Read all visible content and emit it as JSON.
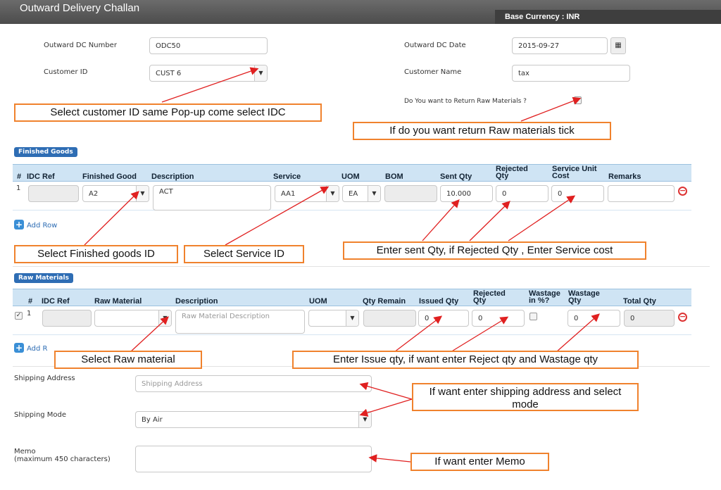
{
  "header": {
    "title": "Outward Delivery Challan",
    "currency": "Base Currency : INR"
  },
  "form": {
    "dc_number_label": "Outward DC Number",
    "dc_number_value": "ODC50",
    "dc_date_label": "Outward DC Date",
    "dc_date_value": "2015-09-27",
    "customer_id_label": "Customer ID",
    "customer_id_value": "CUST 6",
    "customer_name_label": "Customer Name",
    "customer_name_value": "tax",
    "return_raw_label": "Do You want to Return Raw Materials ?"
  },
  "finished_goods": {
    "tag": "Finished Goods",
    "headers": {
      "hash": "#",
      "idc_ref": "IDC Ref",
      "finished_good": "Finished Good",
      "description": "Description",
      "service": "Service",
      "uom": "UOM",
      "bom": "BOM",
      "sent_qty": "Sent Qty",
      "rejected_qty": "Rejected Qty",
      "service_unit_cost": "Service Unit Cost",
      "remarks": "Remarks"
    },
    "row": {
      "num": "1",
      "finished_good": "A2",
      "description": "ACT",
      "service": "AA1",
      "uom": "EA",
      "sent_qty": "10.000",
      "rejected_qty": "0",
      "service_cost": "0"
    },
    "add_row": "Add Row"
  },
  "raw_materials": {
    "tag": "Raw Materials",
    "headers": {
      "hash": "#",
      "idc_ref": "IDC Ref",
      "raw_material": "Raw Material",
      "description": "Description",
      "uom": "UOM",
      "qty_remain": "Qty Remain",
      "issued_qty": "Issued Qty",
      "rejected_qty": "Rejected Qty",
      "wastage_pct": "Wastage in %?",
      "wastage_qty": "Wastage Qty",
      "total_qty": "Total Qty"
    },
    "row": {
      "num": "1",
      "description_placeholder": "Raw Material Description",
      "issued_qty": "0",
      "rejected_qty": "0",
      "wastage_qty": "0",
      "total_qty": "0"
    },
    "add_row": "Add R"
  },
  "shipping": {
    "address_label": "Shipping Address",
    "address_placeholder": "Shipping Address",
    "mode_label": "Shipping Mode",
    "mode_value": "By Air",
    "memo_label": "Memo",
    "memo_sub": "(maximum 450 characters)"
  },
  "notes": {
    "customer": "Select customer ID  same  Pop-up come select IDC",
    "raw_tick": "If do you want return Raw materials tick",
    "finished": "Select Finished goods ID",
    "service": "Select Service ID",
    "sent_qty": "Enter sent Qty, if Rejected Qty , Enter Service cost",
    "raw_material": "Select Raw material",
    "issue_qty": "Enter  Issue qty, if want enter Reject qty and Wastage qty",
    "shipping": "If want enter shipping address  and select mode",
    "memo": "If want enter Memo"
  },
  "colors": {
    "annotation_border": "#f0822d",
    "annotation_arrow": "#e02020",
    "grid_header": "#cfe4f4",
    "tag_blue": "#2e6db4"
  }
}
